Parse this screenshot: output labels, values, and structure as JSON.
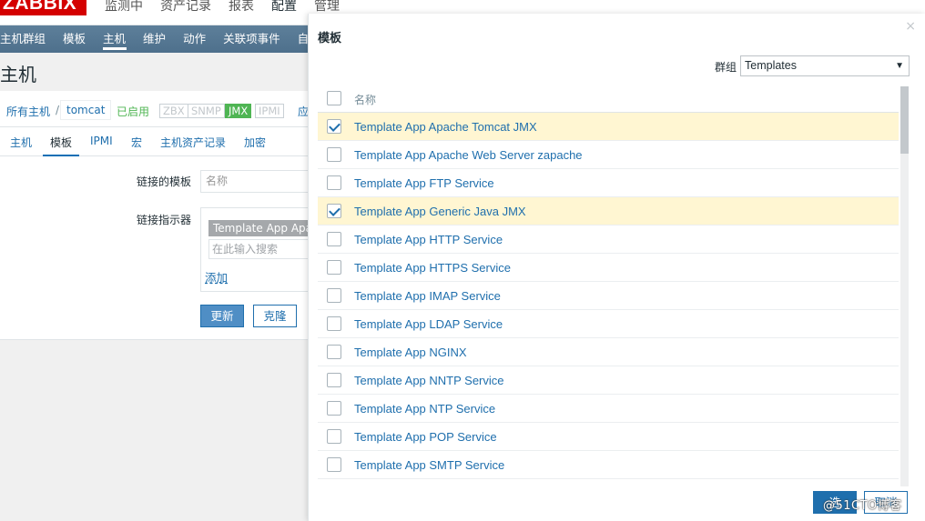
{
  "topbar": {
    "logo": "ZABBIX",
    "menu": [
      "监测中",
      "资产记录",
      "报表",
      "配置",
      "管理"
    ]
  },
  "submenu": [
    "主机群组",
    "模板",
    "主机",
    "维护",
    "动作",
    "关联项事件",
    "自"
  ],
  "page": {
    "title": "主机",
    "breadcrumb": {
      "all_hosts": "所有主机",
      "sep": "/",
      "host": "tomcat",
      "status": "已启用",
      "badges": [
        "ZBX",
        "SNMP",
        "JMX",
        "IPMI"
      ],
      "more": "应"
    },
    "tabs": [
      "主机",
      "模板",
      "IPMI",
      "宏",
      "主机资产记录",
      "加密"
    ],
    "form": {
      "linked_templates_label": "链接的模板",
      "name_placeholder": "名称",
      "link_indicator_label": "链接指示器",
      "chip": "Template App Apache Tomcat JMX",
      "search_placeholder": "在此输入搜索",
      "add_label": "添加",
      "update_label": "更新",
      "clone_label": "克隆"
    }
  },
  "modal": {
    "title": "模板",
    "close_glyph": "×",
    "group_label": "群组",
    "group_value": "Templates",
    "header_name": "名称",
    "rows": [
      {
        "name": "Template App Apache Tomcat JMX",
        "checked": true
      },
      {
        "name": "Template App Apache Web Server zapache",
        "checked": false
      },
      {
        "name": "Template App FTP Service",
        "checked": false
      },
      {
        "name": "Template App Generic Java JMX",
        "checked": true
      },
      {
        "name": "Template App HTTP Service",
        "checked": false
      },
      {
        "name": "Template App HTTPS Service",
        "checked": false
      },
      {
        "name": "Template App IMAP Service",
        "checked": false
      },
      {
        "name": "Template App LDAP Service",
        "checked": false
      },
      {
        "name": "Template App NGINX",
        "checked": false
      },
      {
        "name": "Template App NNTP Service",
        "checked": false
      },
      {
        "name": "Template App NTP Service",
        "checked": false
      },
      {
        "name": "Template App POP Service",
        "checked": false
      },
      {
        "name": "Template App SMTP Service",
        "checked": false
      }
    ],
    "select_label": "选",
    "cancel_label": "取消"
  },
  "watermark": "@51CTO博客"
}
